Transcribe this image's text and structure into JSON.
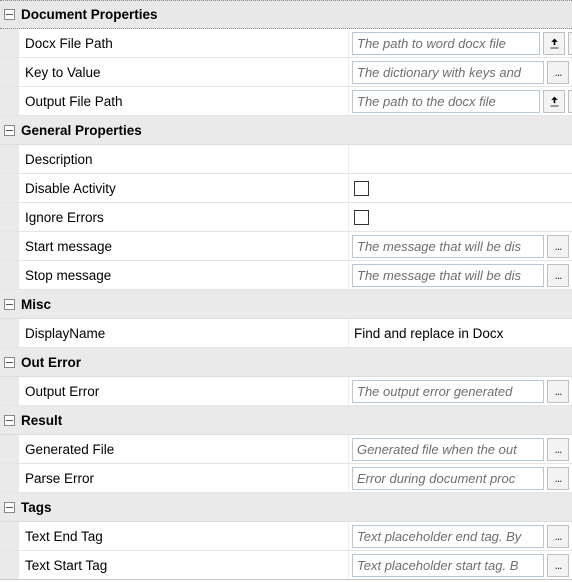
{
  "categories": {
    "doc": "Document Properties",
    "gen": "General Properties",
    "misc": "Misc",
    "outerr": "Out Error",
    "result": "Result",
    "tags": "Tags"
  },
  "props": {
    "docxFilePath": {
      "label": "Docx File Path",
      "placeholder": "The path to word docx file"
    },
    "keyToValue": {
      "label": "Key to Value",
      "placeholder": "The dictionary with keys and"
    },
    "outputFilePath": {
      "label": "Output File Path",
      "placeholder": "The path to the docx file"
    },
    "description": {
      "label": "Description",
      "value": ""
    },
    "disableActivity": {
      "label": "Disable Activity"
    },
    "ignoreErrors": {
      "label": "Ignore Errors"
    },
    "startMessage": {
      "label": "Start message",
      "placeholder": "The message that will be dis"
    },
    "stopMessage": {
      "label": "Stop message",
      "placeholder": "The message that will be dis"
    },
    "displayName": {
      "label": "DisplayName",
      "value": "Find and replace in Docx"
    },
    "outputError": {
      "label": "Output Error",
      "placeholder": "The output error generated "
    },
    "generatedFile": {
      "label": "Generated File",
      "placeholder": "Generated file when the out"
    },
    "parseError": {
      "label": "Parse Error",
      "placeholder": "Error during document proc"
    },
    "textEndTag": {
      "label": "Text End Tag",
      "placeholder": "Text placeholder end tag. By"
    },
    "textStartTag": {
      "label": "Text Start Tag",
      "placeholder": "Text placeholder start tag. B"
    }
  },
  "buttons": {
    "ellipsis": "..."
  }
}
